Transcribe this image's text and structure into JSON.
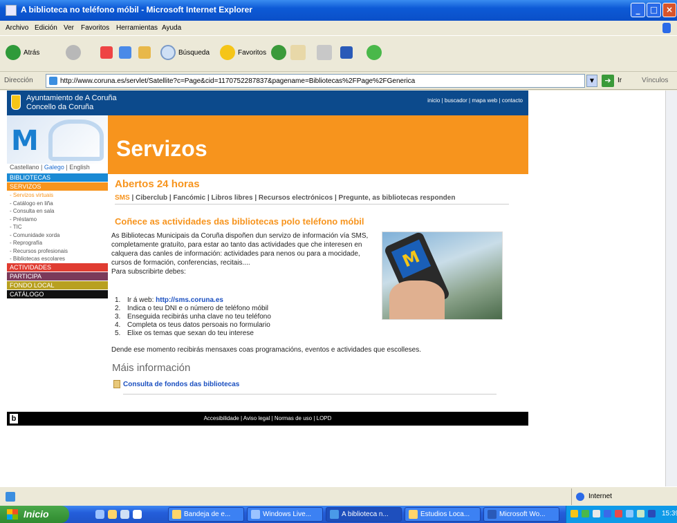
{
  "window": {
    "title": "A biblioteca no teléfono móbil - Microsoft Internet Explorer"
  },
  "menu": [
    "Archivo",
    "Edición",
    "Ver",
    "Favoritos",
    "Herramientas",
    "Ayuda"
  ],
  "toolbar": {
    "back": "Atrás",
    "search": "Búsqueda",
    "favorites": "Favoritos"
  },
  "address": {
    "label": "Dirección",
    "url": "http://www.coruna.es/servlet/Satellite?c=Page&cid=1170752287837&pagename=Bibliotecas%2FPage%2FGenerica",
    "go": "Ir",
    "links": "Vínculos"
  },
  "site": {
    "org_line1": "Ayuntamiento de A Coruña",
    "org_line2": "Concello da Coruña",
    "top_links": "inicio | buscador | mapa web | contacto",
    "banner_title": "Servizos",
    "langs": {
      "castellano": "Castellano",
      "galego": "Galego",
      "english": "English"
    },
    "nav": {
      "bibliotecas": "BIBLIOTECAS",
      "servizos": "SERVIZOS",
      "servizos_items": [
        "- Servizos virtuais",
        "- Catálogo en liña",
        "- Consulta en sala",
        "- Préstamo",
        "- TIC",
        "- Comunidade xorda",
        "- Reprografía",
        "- Recursos profesionais",
        "- Bibliotecas escolares"
      ],
      "actividades": "ACTIVIDADES",
      "participa": "PARTICIPA",
      "fondo_local": "FONDO LOCAL",
      "catalogo": "CATÁLOGO"
    },
    "section_title": "Abertos 24 horas",
    "tabs": {
      "sms": "SMS",
      "rest": " | Ciberclub | Fancómic | Libros libres | Recursos electrónicos | Pregunte, as bibliotecas responden"
    },
    "article_title": "Coñece as actividades das bibliotecas polo teléfono móbil",
    "article_body": "As Bibliotecas Municipais da Coruña dispoñen dun servizo de información vía SMS, completamente gratuíto, para estar ao tanto das actividades que che interesen en calquera das canles de información: actividades para nenos ou para a mocidade, cursos de formación, conferencias, recitais....",
    "subscribe_intro": "Para subscribirte debes:",
    "steps": [
      {
        "num": "1.",
        "text": "Ir á web: ",
        "link": "http://sms.coruna.es"
      },
      {
        "num": "2.",
        "text": "Indica o teu DNI e o número de teléfono móbil",
        "link": ""
      },
      {
        "num": "3.",
        "text": "Enseguida recibirás unha clave no teu teléfono",
        "link": ""
      },
      {
        "num": "4.",
        "text": "Completa os teus datos persoais no formulario",
        "link": ""
      },
      {
        "num": "5.",
        "text": "Elixe os temas que sexan do teu interese",
        "link": ""
      }
    ],
    "outro": "Dende ese momento recibirás mensaxes coas programacións, eventos e actividades que escolleses.",
    "more_info": "Máis información",
    "more_link": "Consulta de fondos das bibliotecas",
    "footer_links": "Accesibilidade | Aviso legal | Normas de uso | LOPD"
  },
  "status": {
    "zone": "Internet"
  },
  "taskbar": {
    "start": "Inicio",
    "tasks": [
      "Bandeja de e...",
      "Windows Live...",
      "A biblioteca n...",
      "Estudios Loca...",
      "Microsoft Wo..."
    ],
    "clock": "15:39"
  },
  "colors": {
    "accent": "#f7941d",
    "navy": "#0c4a8c",
    "bibliotecas": "#1a8ad4",
    "actividades": "#e03c31",
    "participa": "#7a3a5a",
    "fondo_local": "#b8a020",
    "catalogo": "#111111"
  }
}
